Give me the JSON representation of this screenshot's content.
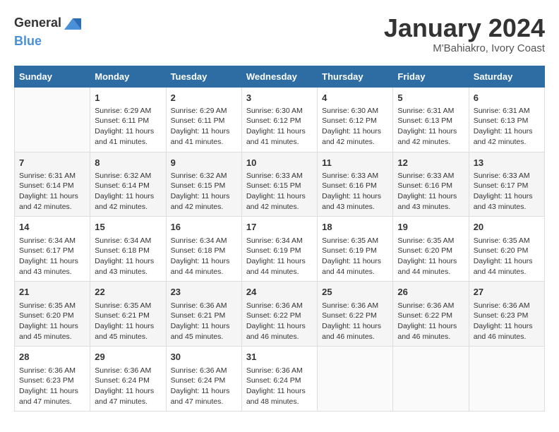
{
  "header": {
    "logo_general": "General",
    "logo_blue": "Blue",
    "month_year": "January 2024",
    "location": "M'Bahiakro, Ivory Coast"
  },
  "days_of_week": [
    "Sunday",
    "Monday",
    "Tuesday",
    "Wednesday",
    "Thursday",
    "Friday",
    "Saturday"
  ],
  "weeks": [
    [
      {
        "day": "",
        "sunrise": "",
        "sunset": "",
        "daylight": ""
      },
      {
        "day": "1",
        "sunrise": "Sunrise: 6:29 AM",
        "sunset": "Sunset: 6:11 PM",
        "daylight": "Daylight: 11 hours and 41 minutes."
      },
      {
        "day": "2",
        "sunrise": "Sunrise: 6:29 AM",
        "sunset": "Sunset: 6:11 PM",
        "daylight": "Daylight: 11 hours and 41 minutes."
      },
      {
        "day": "3",
        "sunrise": "Sunrise: 6:30 AM",
        "sunset": "Sunset: 6:12 PM",
        "daylight": "Daylight: 11 hours and 41 minutes."
      },
      {
        "day": "4",
        "sunrise": "Sunrise: 6:30 AM",
        "sunset": "Sunset: 6:12 PM",
        "daylight": "Daylight: 11 hours and 42 minutes."
      },
      {
        "day": "5",
        "sunrise": "Sunrise: 6:31 AM",
        "sunset": "Sunset: 6:13 PM",
        "daylight": "Daylight: 11 hours and 42 minutes."
      },
      {
        "day": "6",
        "sunrise": "Sunrise: 6:31 AM",
        "sunset": "Sunset: 6:13 PM",
        "daylight": "Daylight: 11 hours and 42 minutes."
      }
    ],
    [
      {
        "day": "7",
        "sunrise": "Sunrise: 6:31 AM",
        "sunset": "Sunset: 6:14 PM",
        "daylight": "Daylight: 11 hours and 42 minutes."
      },
      {
        "day": "8",
        "sunrise": "Sunrise: 6:32 AM",
        "sunset": "Sunset: 6:14 PM",
        "daylight": "Daylight: 11 hours and 42 minutes."
      },
      {
        "day": "9",
        "sunrise": "Sunrise: 6:32 AM",
        "sunset": "Sunset: 6:15 PM",
        "daylight": "Daylight: 11 hours and 42 minutes."
      },
      {
        "day": "10",
        "sunrise": "Sunrise: 6:33 AM",
        "sunset": "Sunset: 6:15 PM",
        "daylight": "Daylight: 11 hours and 42 minutes."
      },
      {
        "day": "11",
        "sunrise": "Sunrise: 6:33 AM",
        "sunset": "Sunset: 6:16 PM",
        "daylight": "Daylight: 11 hours and 43 minutes."
      },
      {
        "day": "12",
        "sunrise": "Sunrise: 6:33 AM",
        "sunset": "Sunset: 6:16 PM",
        "daylight": "Daylight: 11 hours and 43 minutes."
      },
      {
        "day": "13",
        "sunrise": "Sunrise: 6:33 AM",
        "sunset": "Sunset: 6:17 PM",
        "daylight": "Daylight: 11 hours and 43 minutes."
      }
    ],
    [
      {
        "day": "14",
        "sunrise": "Sunrise: 6:34 AM",
        "sunset": "Sunset: 6:17 PM",
        "daylight": "Daylight: 11 hours and 43 minutes."
      },
      {
        "day": "15",
        "sunrise": "Sunrise: 6:34 AM",
        "sunset": "Sunset: 6:18 PM",
        "daylight": "Daylight: 11 hours and 43 minutes."
      },
      {
        "day": "16",
        "sunrise": "Sunrise: 6:34 AM",
        "sunset": "Sunset: 6:18 PM",
        "daylight": "Daylight: 11 hours and 44 minutes."
      },
      {
        "day": "17",
        "sunrise": "Sunrise: 6:34 AM",
        "sunset": "Sunset: 6:19 PM",
        "daylight": "Daylight: 11 hours and 44 minutes."
      },
      {
        "day": "18",
        "sunrise": "Sunrise: 6:35 AM",
        "sunset": "Sunset: 6:19 PM",
        "daylight": "Daylight: 11 hours and 44 minutes."
      },
      {
        "day": "19",
        "sunrise": "Sunrise: 6:35 AM",
        "sunset": "Sunset: 6:20 PM",
        "daylight": "Daylight: 11 hours and 44 minutes."
      },
      {
        "day": "20",
        "sunrise": "Sunrise: 6:35 AM",
        "sunset": "Sunset: 6:20 PM",
        "daylight": "Daylight: 11 hours and 44 minutes."
      }
    ],
    [
      {
        "day": "21",
        "sunrise": "Sunrise: 6:35 AM",
        "sunset": "Sunset: 6:20 PM",
        "daylight": "Daylight: 11 hours and 45 minutes."
      },
      {
        "day": "22",
        "sunrise": "Sunrise: 6:35 AM",
        "sunset": "Sunset: 6:21 PM",
        "daylight": "Daylight: 11 hours and 45 minutes."
      },
      {
        "day": "23",
        "sunrise": "Sunrise: 6:36 AM",
        "sunset": "Sunset: 6:21 PM",
        "daylight": "Daylight: 11 hours and 45 minutes."
      },
      {
        "day": "24",
        "sunrise": "Sunrise: 6:36 AM",
        "sunset": "Sunset: 6:22 PM",
        "daylight": "Daylight: 11 hours and 46 minutes."
      },
      {
        "day": "25",
        "sunrise": "Sunrise: 6:36 AM",
        "sunset": "Sunset: 6:22 PM",
        "daylight": "Daylight: 11 hours and 46 minutes."
      },
      {
        "day": "26",
        "sunrise": "Sunrise: 6:36 AM",
        "sunset": "Sunset: 6:22 PM",
        "daylight": "Daylight: 11 hours and 46 minutes."
      },
      {
        "day": "27",
        "sunrise": "Sunrise: 6:36 AM",
        "sunset": "Sunset: 6:23 PM",
        "daylight": "Daylight: 11 hours and 46 minutes."
      }
    ],
    [
      {
        "day": "28",
        "sunrise": "Sunrise: 6:36 AM",
        "sunset": "Sunset: 6:23 PM",
        "daylight": "Daylight: 11 hours and 47 minutes."
      },
      {
        "day": "29",
        "sunrise": "Sunrise: 6:36 AM",
        "sunset": "Sunset: 6:24 PM",
        "daylight": "Daylight: 11 hours and 47 minutes."
      },
      {
        "day": "30",
        "sunrise": "Sunrise: 6:36 AM",
        "sunset": "Sunset: 6:24 PM",
        "daylight": "Daylight: 11 hours and 47 minutes."
      },
      {
        "day": "31",
        "sunrise": "Sunrise: 6:36 AM",
        "sunset": "Sunset: 6:24 PM",
        "daylight": "Daylight: 11 hours and 48 minutes."
      },
      {
        "day": "",
        "sunrise": "",
        "sunset": "",
        "daylight": ""
      },
      {
        "day": "",
        "sunrise": "",
        "sunset": "",
        "daylight": ""
      },
      {
        "day": "",
        "sunrise": "",
        "sunset": "",
        "daylight": ""
      }
    ]
  ]
}
